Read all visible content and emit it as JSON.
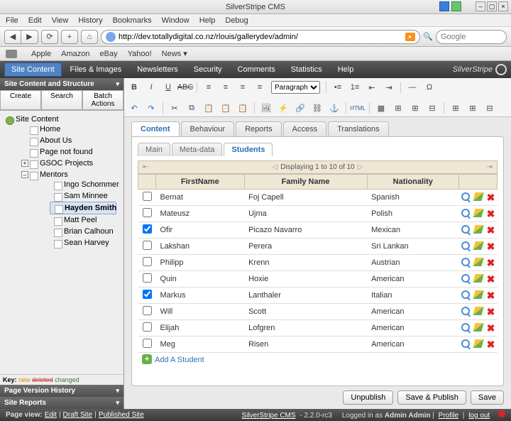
{
  "window": {
    "title": "SilverStripe CMS"
  },
  "menubar": [
    "File",
    "Edit",
    "View",
    "History",
    "Bookmarks",
    "Window",
    "Help",
    "Debug"
  ],
  "url": "http://dev.totallydigital.co.nz/rlouis/gallerydev/admin/",
  "search_placeholder": "Google",
  "bookmarks": [
    "Apple",
    "Amazon",
    "eBay",
    "Yahoo!",
    "News ▾"
  ],
  "cmsnav": {
    "tabs": [
      "Site Content",
      "Files & Images",
      "Newsletters",
      "Security",
      "Comments",
      "Statistics",
      "Help"
    ],
    "active": 0,
    "brand": "SilverStripe"
  },
  "sidebar": {
    "title": "Site Content and Structure",
    "subtabs": [
      "Create",
      "Search",
      "Batch Actions"
    ],
    "root": "Site Content",
    "pages": [
      "Home",
      "About Us",
      "Page not found",
      "GSOC Projects",
      "Mentors"
    ],
    "mentors": [
      "Ingo Schommer",
      "Sam Minnee",
      "Hayden Smith",
      "Matt Peel",
      "Brian Calhoun",
      "Sean Harvey"
    ],
    "selected": "Hayden Smith",
    "key": {
      "label": "Key:",
      "new": "new",
      "deleted": "deleted",
      "changed": "changed"
    },
    "panels": [
      "Page Version History",
      "Site Reports"
    ]
  },
  "editor_tabs": {
    "items": [
      "Content",
      "Behaviour",
      "Reports",
      "Access",
      "Translations"
    ],
    "active": 0
  },
  "inner_tabs": {
    "items": [
      "Main",
      "Meta-data",
      "Students"
    ],
    "active": 2
  },
  "paginator": {
    "text": "Displaying 1 to 10 of 10"
  },
  "grid": {
    "headers": [
      "FirstName",
      "Family Name",
      "Nationality"
    ],
    "rows": [
      {
        "first": "Bernat",
        "family": "Foj Capell",
        "nat": "Spanish",
        "checked": false
      },
      {
        "first": "Mateusz",
        "family": "Ujma",
        "nat": "Polish",
        "checked": false
      },
      {
        "first": "Ofir",
        "family": "Picazo Navarro",
        "nat": "Mexican",
        "checked": true
      },
      {
        "first": "Lakshan",
        "family": "Perera",
        "nat": "Sri Lankan",
        "checked": false
      },
      {
        "first": "Philipp",
        "family": "Krenn",
        "nat": "Austrian",
        "checked": false
      },
      {
        "first": "Quin",
        "family": "Hoxie",
        "nat": "American",
        "checked": false
      },
      {
        "first": "Markus",
        "family": "Lanthaler",
        "nat": "Italian",
        "checked": true
      },
      {
        "first": "Will",
        "family": "Scott",
        "nat": "American",
        "checked": false
      },
      {
        "first": "Elijah",
        "family": "Lofgren",
        "nat": "American",
        "checked": false
      },
      {
        "first": "Meg",
        "family": "Risen",
        "nat": "American",
        "checked": false
      }
    ],
    "add_label": "Add A Student"
  },
  "actions": {
    "unpublish": "Unpublish",
    "savepub": "Save & Publish",
    "save": "Save"
  },
  "footer": {
    "pageview_label": "Page view:",
    "links": [
      "Edit",
      "Draft Site",
      "Published Site"
    ],
    "product": "SilverStripe CMS",
    "version": "- 2.2.0-rc3",
    "login_prefix": "Logged in as",
    "user": "Admin Admin",
    "profile": "Profile",
    "logout": "log out"
  },
  "format_dropdown": "Paragraph"
}
